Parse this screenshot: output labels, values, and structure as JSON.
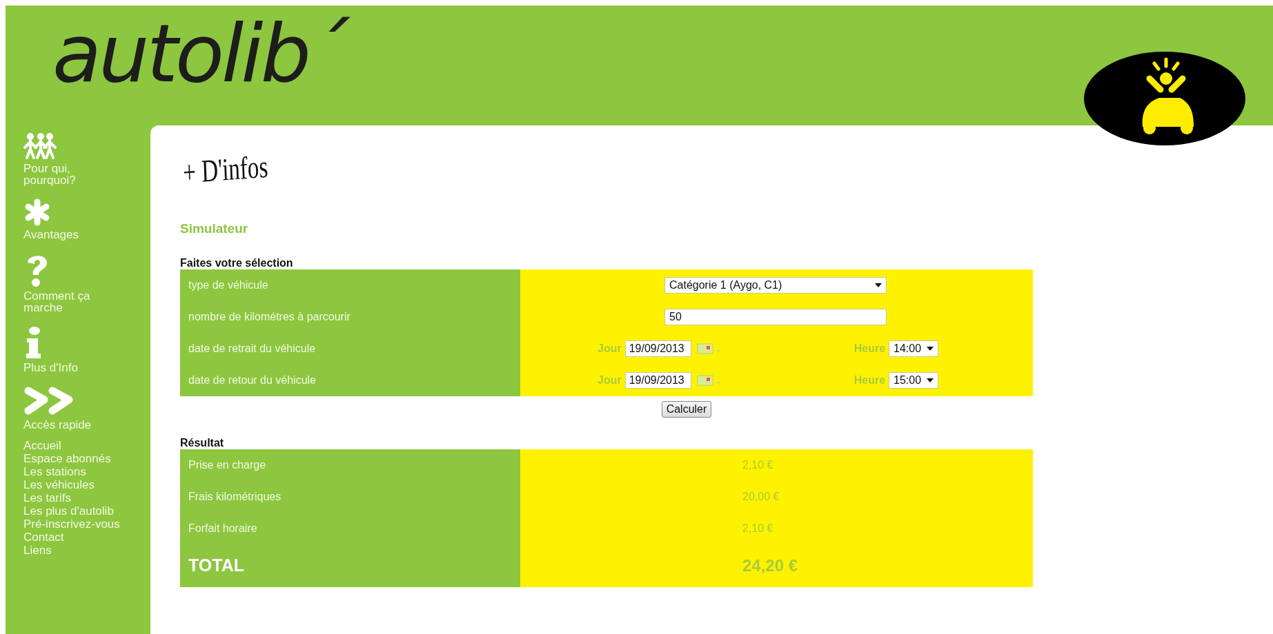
{
  "logo": {
    "text": "autolib´"
  },
  "sidebar": {
    "items": [
      {
        "kind": "people",
        "label": "Pour qui,\npourquoi?"
      },
      {
        "kind": "asterisk",
        "label": "Avantages"
      },
      {
        "kind": "question",
        "label": "Comment ça\nmarche"
      },
      {
        "kind": "info",
        "label": "Plus d'Info"
      },
      {
        "kind": "forward",
        "label": "Accès rapide"
      }
    ],
    "links": [
      "Accueil",
      "Espace abonnés",
      "Les stations",
      "Les véhicules",
      "Les tarifs",
      "Les plus d'autolib",
      "Pré-inscrivez-vous",
      "Contact",
      "Liens"
    ]
  },
  "heading": "+ D'infos",
  "section_title": "Simulateur",
  "selection": {
    "title": "Faites votre sélection",
    "rows": [
      {
        "kind": "select",
        "label": "type de véhicule",
        "value": "Catégorie 1 (Aygo, C1)"
      },
      {
        "kind": "text",
        "label": "nombre de kilométres à parcourir",
        "value": "50"
      },
      {
        "kind": "datetime",
        "label": "date de retrait du véhicule",
        "day_label": "Jour",
        "day": "19/09/2013",
        "hour_label": "Heure",
        "hour": "14:00"
      },
      {
        "kind": "datetime",
        "label": "date de retour du véhicule",
        "day_label": "Jour",
        "day": "19/09/2013",
        "hour_label": "Heure",
        "hour": "15:00"
      }
    ]
  },
  "button": "Calculer",
  "result": {
    "title": "Résultat",
    "rows": [
      {
        "kind": "line",
        "label": "Prise en charge",
        "value": "2,10 €"
      },
      {
        "kind": "line",
        "label": "Frais kilométriques",
        "value": "20,00 €"
      },
      {
        "kind": "line",
        "label": "Forfait horaire",
        "value": "2,10 €"
      },
      {
        "kind": "total",
        "label": "TOTAL",
        "value": "24,20 €"
      }
    ]
  }
}
